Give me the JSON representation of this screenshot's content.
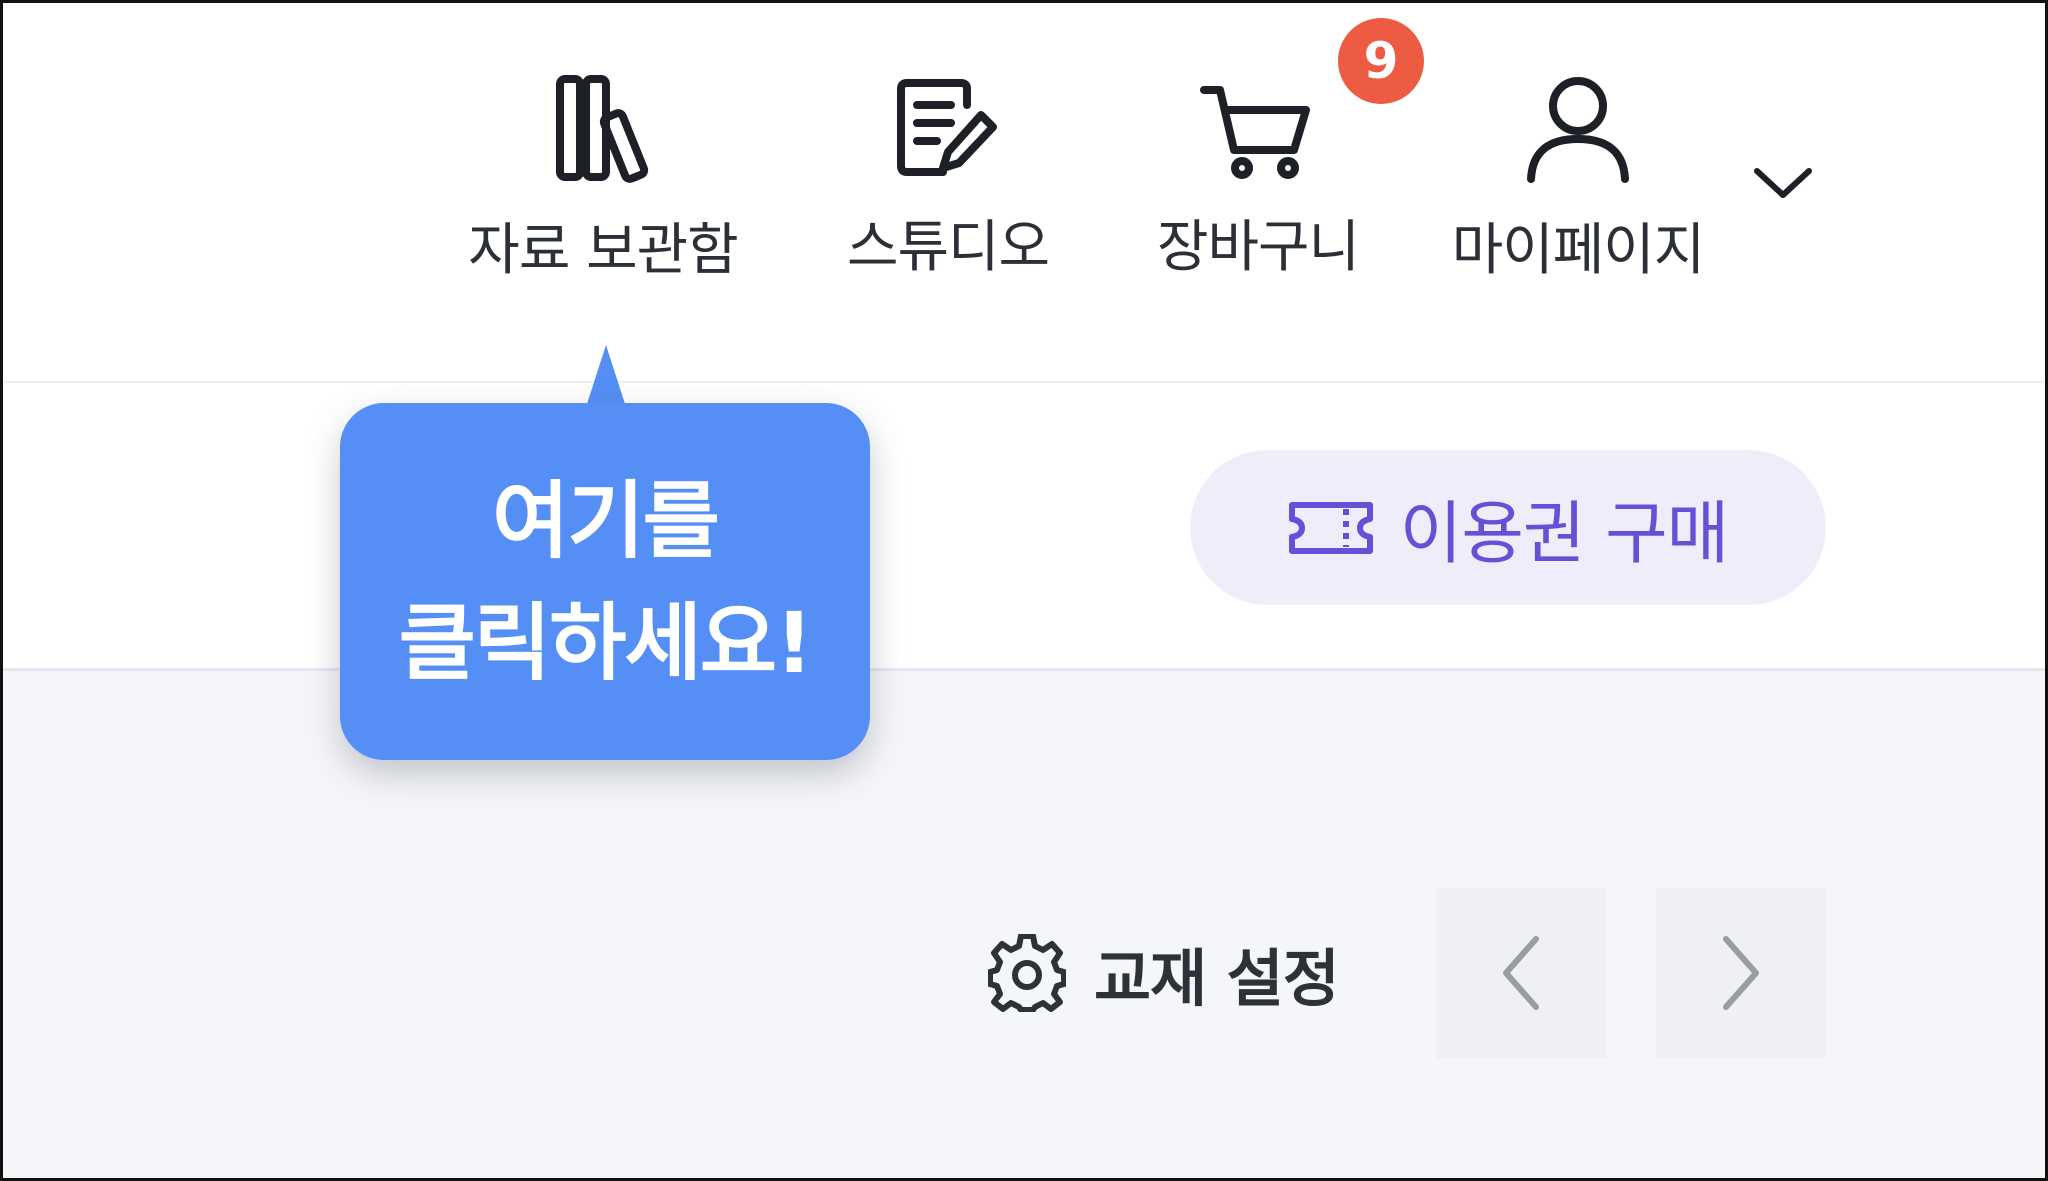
{
  "header": {
    "nav": [
      {
        "label": "자료 보관함",
        "icon": "library-icon"
      },
      {
        "label": "스튜디오",
        "icon": "studio-edit-icon"
      },
      {
        "label": "장바구니",
        "icon": "cart-icon",
        "badge": "9"
      },
      {
        "label": "마이페이지",
        "icon": "user-icon"
      }
    ],
    "dropdown_icon": "chevron-down-icon"
  },
  "tooltip": {
    "line1": "여기를",
    "line2": "클릭하세요!"
  },
  "pass_button": {
    "label": "이용권 구매",
    "icon": "ticket-icon"
  },
  "toolbar": {
    "settings_label": "교재 설정",
    "settings_icon": "gear-icon",
    "prev_icon": "chevron-left-icon",
    "next_icon": "chevron-right-icon"
  },
  "colors": {
    "accent_purple": "#6650d6",
    "tooltip_blue": "#558ff5",
    "badge_red": "#ee5b43",
    "pass_bg": "#eeeefa",
    "lower_bg": "#f5f6f9"
  }
}
